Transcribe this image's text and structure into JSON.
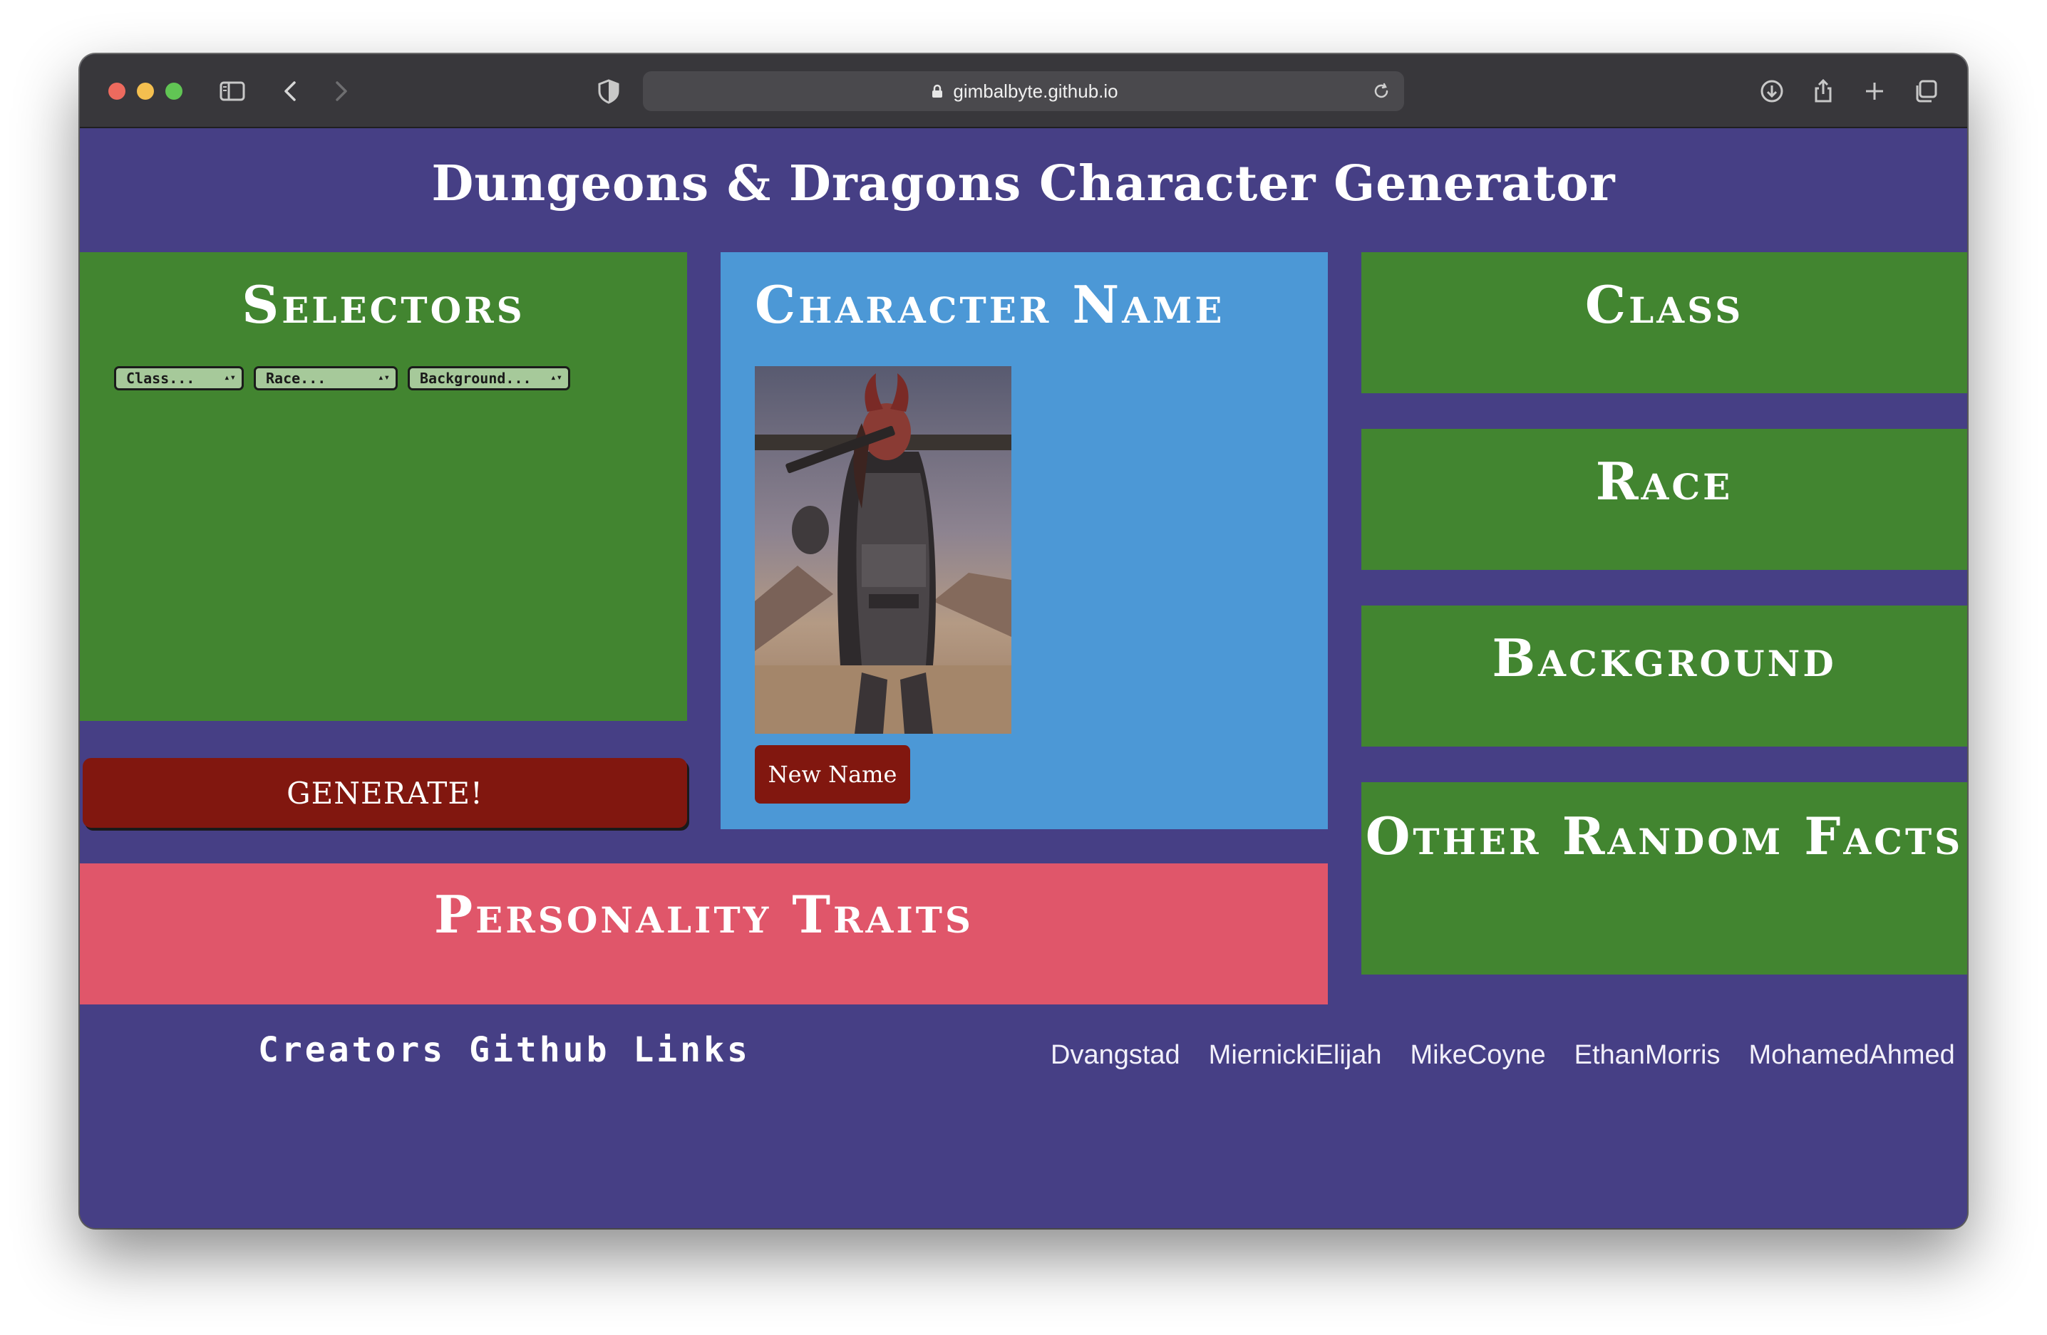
{
  "browser": {
    "url": "gimbalbyte.github.io"
  },
  "site": {
    "title": "Dungeons & Dragons Character Generator"
  },
  "selectors": {
    "heading": "Selectors",
    "dropdowns": [
      {
        "label": "Class..."
      },
      {
        "label": "Race..."
      },
      {
        "label": "Background..."
      }
    ],
    "generate_label": "GENERATE!"
  },
  "character": {
    "heading": "Character Name",
    "new_name_label": "New Name"
  },
  "sections": {
    "class": "Class",
    "race": "Race",
    "background": "Background",
    "other": "Other Random Facts",
    "traits": "Personality Traits"
  },
  "footer": {
    "creators_label": "Creators Github Links",
    "links": [
      "Dvangstad",
      "MiernickiElijah",
      "MikeCoyne",
      "EthanMorris",
      "MohamedAhmed"
    ]
  },
  "colors": {
    "page_bg": "#463f85",
    "panel_green": "#428530",
    "panel_blue": "#4c98d6",
    "panel_pink": "#e0566a",
    "button_red": "#81170f"
  },
  "icons": {
    "sidebar": "sidebar-icon",
    "back": "chevron-left-icon",
    "forward": "chevron-right-icon",
    "shield": "shield-icon",
    "lock": "lock-icon",
    "reload": "reload-icon",
    "download": "download-icon",
    "share": "share-icon",
    "new_tab": "plus-icon",
    "tabs": "tabs-overview-icon"
  }
}
